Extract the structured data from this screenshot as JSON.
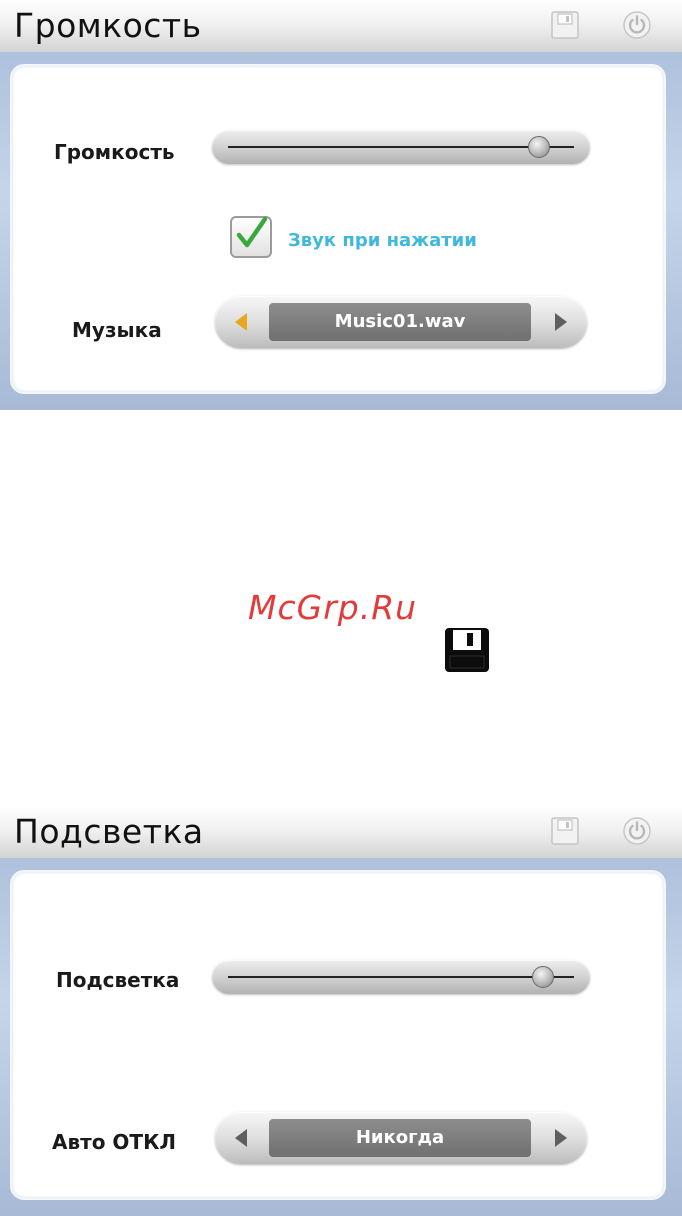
{
  "volume_screen": {
    "title": "Громкость",
    "volume_label": "Громкость",
    "volume_level_percent": 90,
    "key_sound_label": "Звук при нажатии",
    "key_sound_checked": true,
    "music_label": "Музыка",
    "music_value": "Music01.wav",
    "left_arrow_color": "#e6a820",
    "right_arrow_color": "#5f5f5f"
  },
  "watermark": "McGrp.Ru",
  "backlight_screen": {
    "title": "Подсветка",
    "backlight_label": "Подсветка",
    "backlight_level_percent": 91,
    "auto_off_label": "Авто ОТКЛ",
    "auto_off_value": "Никогда",
    "left_arrow_color": "#5f5f5f",
    "right_arrow_color": "#5f5f5f"
  },
  "icons": {
    "save": "floppy-disk-icon",
    "power": "power-icon"
  },
  "colors": {
    "frame_blue": "#b6c8e2",
    "checkbox_text": "#3fb8dd",
    "watermark": "#e43a3a"
  }
}
